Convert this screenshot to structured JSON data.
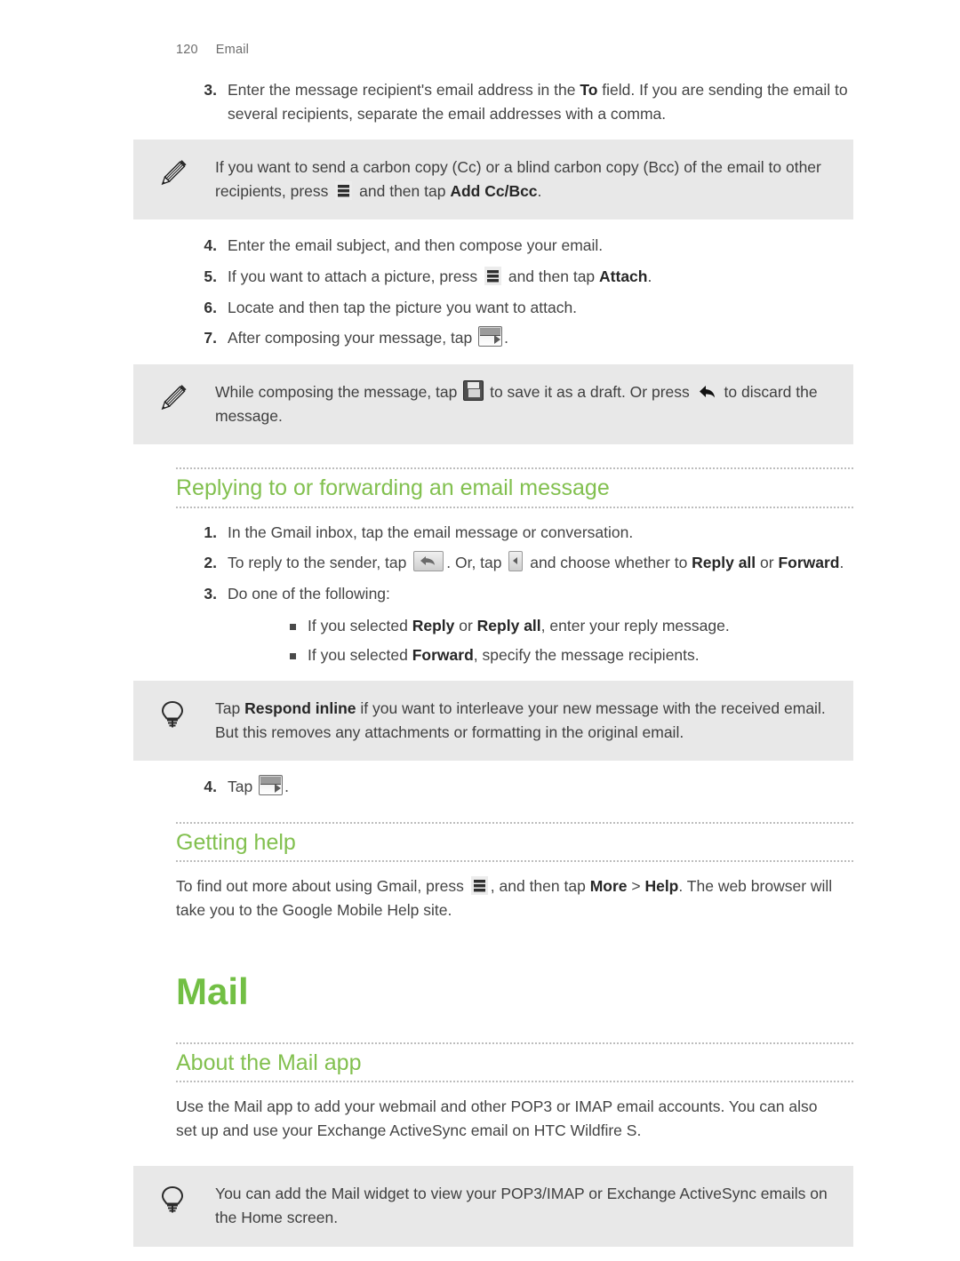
{
  "header": {
    "page_number": "120",
    "section": "Email"
  },
  "colors": {
    "heading_green": "#82c04f",
    "title_green": "#72bf44",
    "callout_bg": "#e8e8e8",
    "body_text": "#444444"
  },
  "gmail_compose_steps": [
    {
      "num": "3.",
      "parts": [
        {
          "t": "Enter the message recipient's email address in the "
        },
        {
          "t": "To",
          "bold": true
        },
        {
          "t": " field. If you are sending the email to several recipients, separate the email addresses with a comma."
        }
      ]
    }
  ],
  "note_cc_bcc": {
    "icon": "pencil-icon",
    "parts": [
      {
        "t": "If you want to send a carbon copy (Cc) or a blind carbon copy (Bcc) of the email to other recipients, press "
      },
      {
        "icon": "menu-icon"
      },
      {
        "t": " and then tap "
      },
      {
        "t": "Add Cc/Bcc",
        "bold": true
      },
      {
        "t": "."
      }
    ]
  },
  "gmail_compose_steps_cont": [
    {
      "num": "4.",
      "parts": [
        {
          "t": "Enter the email subject, and then compose your email."
        }
      ]
    },
    {
      "num": "5.",
      "parts": [
        {
          "t": "If you want to attach a picture, press "
        },
        {
          "icon": "menu-icon"
        },
        {
          "t": " and then tap "
        },
        {
          "t": "Attach",
          "bold": true
        },
        {
          "t": "."
        }
      ]
    },
    {
      "num": "6.",
      "parts": [
        {
          "t": "Locate and then tap the picture you want to attach."
        }
      ]
    },
    {
      "num": "7.",
      "parts": [
        {
          "t": "After composing your message, tap "
        },
        {
          "icon": "send-icon"
        },
        {
          "t": "."
        }
      ]
    }
  ],
  "note_draft": {
    "icon": "pencil-icon",
    "parts": [
      {
        "t": "While composing the message, tap "
      },
      {
        "icon": "save-icon"
      },
      {
        "t": " to save it as a draft. Or press "
      },
      {
        "icon": "back-arrow-icon"
      },
      {
        "t": " to discard the message."
      }
    ]
  },
  "section_replying": {
    "heading": "Replying to or forwarding an email message",
    "steps": [
      {
        "num": "1.",
        "parts": [
          {
            "t": "In the Gmail inbox, tap the email message or conversation."
          }
        ]
      },
      {
        "num": "2.",
        "parts": [
          {
            "t": "To reply to the sender, tap "
          },
          {
            "icon": "reply-icon"
          },
          {
            "t": ". Or, tap "
          },
          {
            "icon": "caret-left-icon"
          },
          {
            "t": " and choose whether to "
          },
          {
            "t": "Reply all",
            "bold": true
          },
          {
            "t": " or "
          },
          {
            "t": "Forward",
            "bold": true
          },
          {
            "t": "."
          }
        ]
      },
      {
        "num": "3.",
        "parts": [
          {
            "t": "Do one of the following:"
          }
        ],
        "bullets": [
          [
            {
              "t": "If you selected "
            },
            {
              "t": "Reply",
              "bold": true
            },
            {
              "t": " or "
            },
            {
              "t": "Reply all",
              "bold": true
            },
            {
              "t": ", enter your reply message."
            }
          ],
          [
            {
              "t": "If you selected "
            },
            {
              "t": "Forward",
              "bold": true
            },
            {
              "t": ", specify the message recipients."
            }
          ]
        ]
      }
    ],
    "tip": {
      "icon": "lightbulb-icon",
      "parts": [
        {
          "t": "Tap "
        },
        {
          "t": "Respond inline",
          "bold": true
        },
        {
          "t": " if you want to interleave your new message with the received email. But this removes any attachments or formatting in the original email."
        }
      ]
    },
    "final_step": {
      "num": "4.",
      "parts": [
        {
          "t": "Tap "
        },
        {
          "icon": "send-icon"
        },
        {
          "t": "."
        }
      ]
    }
  },
  "section_getting_help": {
    "heading": "Getting help",
    "parts": [
      {
        "t": "To find out more about using Gmail, press "
      },
      {
        "icon": "menu-icon"
      },
      {
        "t": ", and then tap "
      },
      {
        "t": "More",
        "bold": true
      },
      {
        "t": " > "
      },
      {
        "t": "Help",
        "bold": true
      },
      {
        "t": ". The web browser will take you to the Google Mobile Help site."
      }
    ]
  },
  "chapter_mail": {
    "title": "Mail",
    "about": {
      "heading": "About the Mail app",
      "parts": [
        {
          "t": "Use the Mail app to add your webmail and other POP3 or IMAP email accounts. You can also set up and use your Exchange ActiveSync email on HTC Wildfire S."
        }
      ]
    },
    "tip": {
      "icon": "lightbulb-icon",
      "parts": [
        {
          "t": "You can add the Mail widget to view your POP3/IMAP or Exchange ActiveSync emails on the Home screen."
        }
      ]
    }
  }
}
